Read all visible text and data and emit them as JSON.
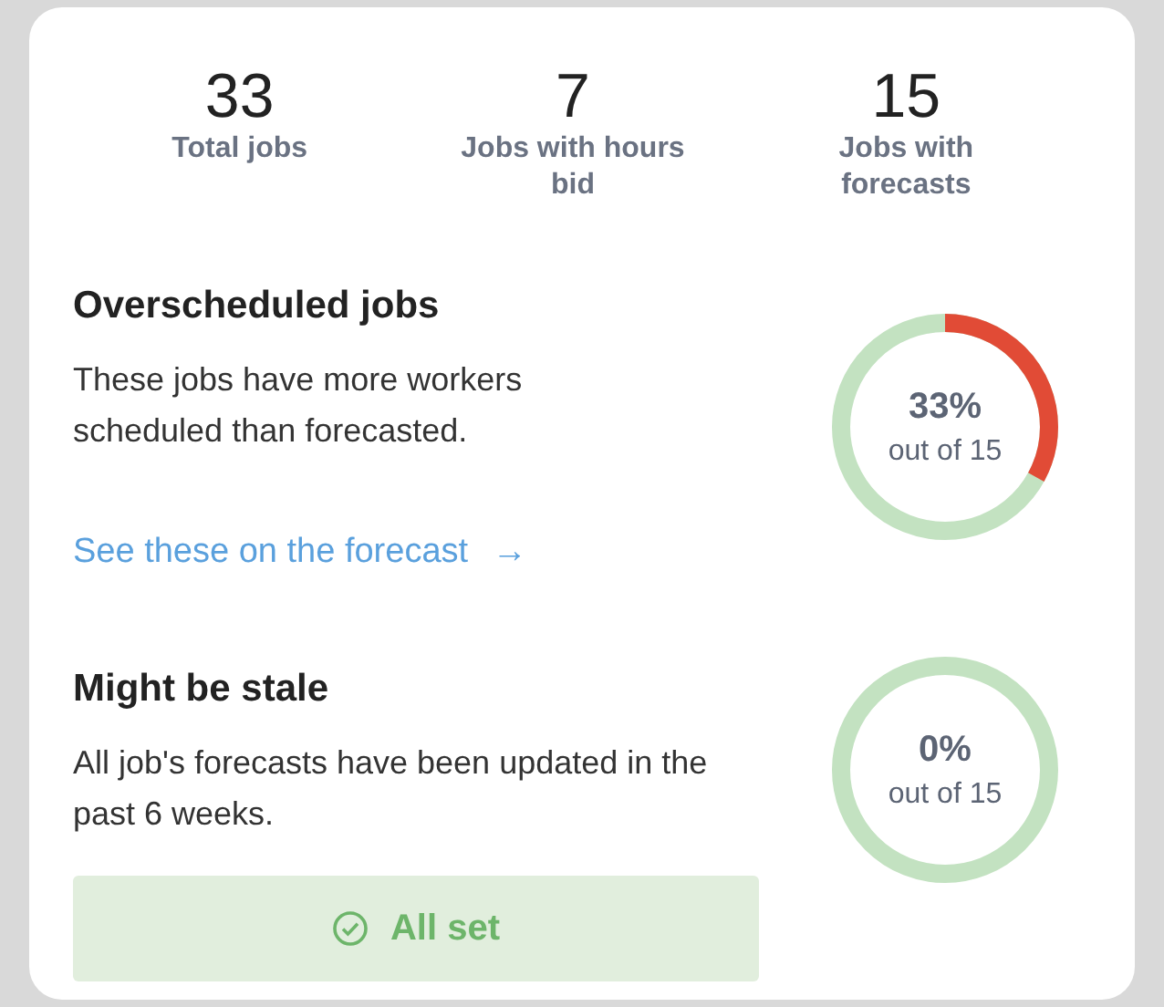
{
  "stats": [
    {
      "value": "33",
      "label": "Total jobs"
    },
    {
      "value": "7",
      "label": "Jobs with hours bid"
    },
    {
      "value": "15",
      "label": "Jobs with forecasts"
    }
  ],
  "sections": [
    {
      "kind": "link",
      "title": "Overscheduled jobs",
      "body": "These jobs have more workers scheduled than forecasted.",
      "action": "See these on the forecast",
      "arrow": "→",
      "ring": {
        "percent": "33%",
        "caption": "out of 15",
        "level": 0.33
      }
    },
    {
      "kind": "banner",
      "title": "Might be stale",
      "body": "All job's forecasts have been updated in the past 6 weeks.",
      "action": "All set",
      "ring": {
        "percent": "0%",
        "caption": "out of 15",
        "level": 0
      }
    }
  ]
}
